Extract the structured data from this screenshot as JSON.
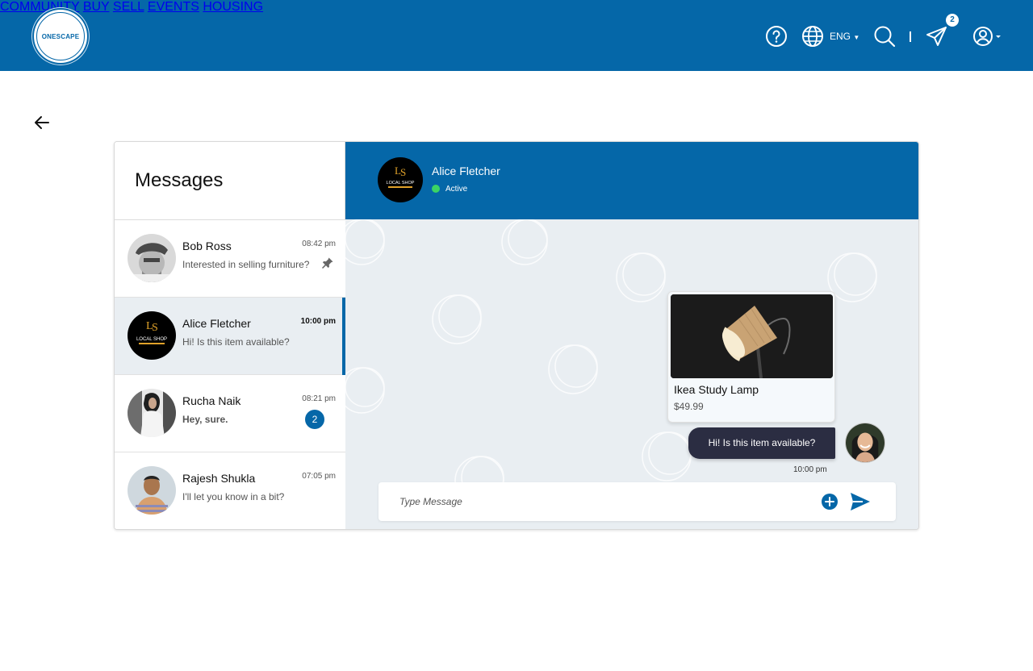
{
  "brand": {
    "logo_text": "ONESCAPE"
  },
  "nav": [
    {
      "label": "COMMUNITY"
    },
    {
      "label": "BUY"
    },
    {
      "label": "SELL"
    },
    {
      "label": "EVENTS"
    },
    {
      "label": "HOUSING"
    }
  ],
  "header": {
    "language": "ENG",
    "notification_count": "2"
  },
  "messages": {
    "title": "Messages",
    "conversations": [
      {
        "name": "Bob Ross",
        "preview": "Interested in selling furniture?",
        "time": "08:42 pm",
        "pinned": true
      },
      {
        "name": "Alice Fletcher",
        "preview": "Hi! Is this item available?",
        "time": "10:00 pm",
        "active": true
      },
      {
        "name": "Rucha Naik",
        "preview": "Hey, sure.",
        "time": "08:21 pm",
        "unread": "2"
      },
      {
        "name": "Rajesh Shukla",
        "preview": "I'll let you know in a bit?",
        "time": "07:05 pm"
      }
    ]
  },
  "chat": {
    "contact_name": "Alice Fletcher",
    "status": "Active",
    "avatar_text": "LOCAL SHOP",
    "product": {
      "name": "Ikea Study Lamp",
      "price": "$49.99"
    },
    "message": {
      "text": "Hi! Is this item available?",
      "time": "10:00 pm"
    },
    "composer_placeholder": "Type Message"
  },
  "colors": {
    "primary": "#0567A8",
    "chat_bg": "#E9EEF2",
    "bubble": "#2B2D42",
    "active_dot": "#3BD464"
  }
}
